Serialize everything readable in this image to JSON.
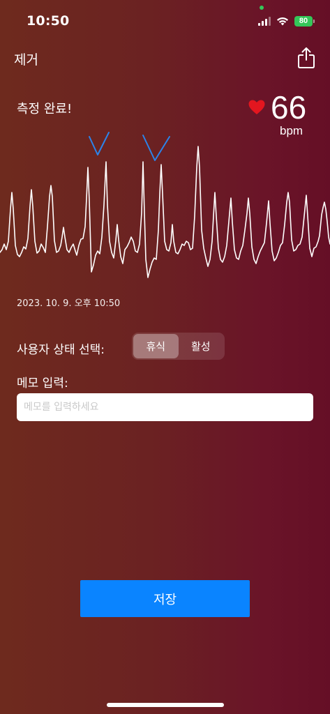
{
  "status_bar": {
    "time": "10:50",
    "battery": "80",
    "icons": [
      "signal-icon",
      "wifi-icon",
      "battery-icon"
    ]
  },
  "nav": {
    "remove_label": "제거",
    "share_icon": "share-icon"
  },
  "measurement": {
    "status": "측정 완료!",
    "bpm": "66",
    "unit": "bpm",
    "heart_color": "#e3161f",
    "timestamp": "2023. 10. 9. 오후 10:50"
  },
  "user_state": {
    "label": "사용자 상태 선택:",
    "options": [
      "휴식",
      "활성"
    ],
    "selected": "휴식"
  },
  "memo": {
    "label": "메모 입력:",
    "value": "",
    "placeholder": "메모를 입력하세요"
  },
  "actions": {
    "save_label": "저장",
    "save_color": "#0a84ff"
  }
}
